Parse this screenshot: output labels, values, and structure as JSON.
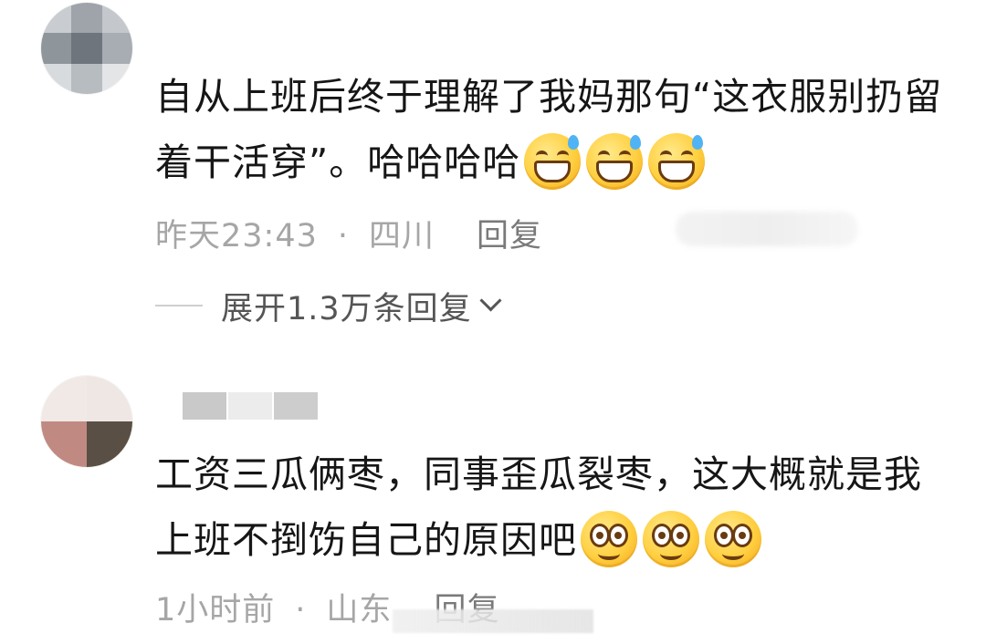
{
  "comments": [
    {
      "text": "自从上班后终于理解了我妈那句“这衣服别扔留着干活穿”。哈哈哈哈",
      "emojis": [
        "grinning-sweat-emoji",
        "grinning-sweat-emoji",
        "grinning-sweat-emoji"
      ],
      "time": "昨天23:43",
      "separator": "·",
      "location": "四川",
      "reply_label": "回复",
      "expand_label": "展开1.3万条回复"
    },
    {
      "text": "工资三瓜俩枣，同事歪瓜裂枣，这大概就是我上班不捯饬自己的原因吧",
      "emojis": [
        "smiling-big-eyes-emoji",
        "smiling-big-eyes-emoji",
        "smiling-big-eyes-emoji"
      ],
      "time": "1小时前",
      "separator": "·",
      "location": "山东",
      "reply_label": "回复"
    }
  ],
  "colors": {
    "meta_text": "#a6a6a6",
    "reply_text": "#7a7a7a",
    "expand_text": "#555555",
    "emoji_yellow": "#ffcf3f"
  }
}
